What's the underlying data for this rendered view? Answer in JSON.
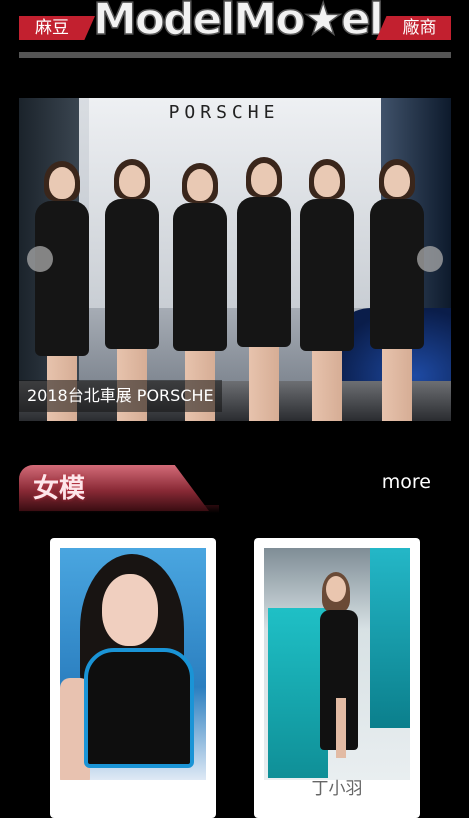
{
  "header": {
    "left_tag": "麻豆",
    "logo_text": "ModelMo★el",
    "right_tag": "廠商",
    "accent_color": "#c2202f"
  },
  "banner": {
    "brand_sign": "PORSCHE",
    "caption": "2018台北車展 PORSCHE",
    "prev_icon": "circle-arrow-left",
    "next_icon": "circle-arrow-right"
  },
  "section": {
    "title": "女模",
    "more_label": "more",
    "tab_color": "#8a2a36"
  },
  "models": [
    {
      "name": ""
    },
    {
      "name": "丁小羽"
    }
  ]
}
